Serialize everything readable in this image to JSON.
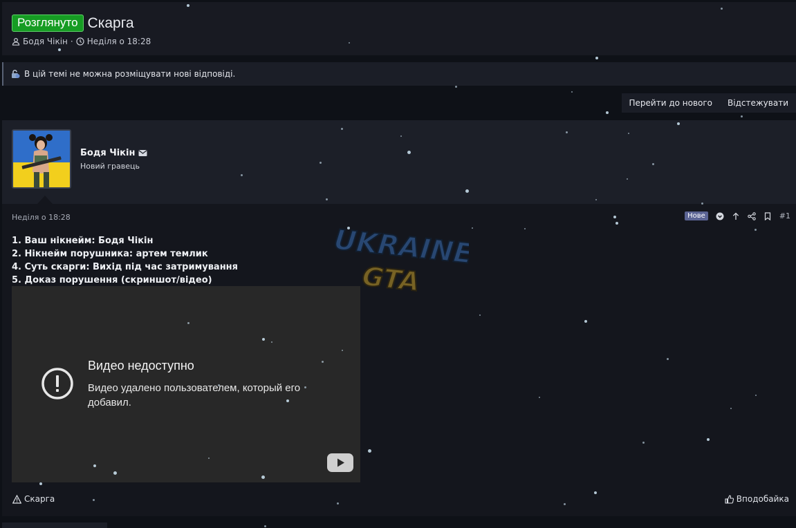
{
  "thread": {
    "status": "Розглянуто",
    "title": "Скарга",
    "author": "Бодя Чікін",
    "separator": "·",
    "date": "Неділя о 18:28"
  },
  "notice": {
    "text": "В цій темі не можна розміщувати нові відповіді."
  },
  "actions": {
    "goto_new": "Перейти до нового",
    "watch": "Відстежувати"
  },
  "post": {
    "user": {
      "name": "Бодя Чікін",
      "title": "Новий гравець"
    },
    "date": "Неділя о 18:28",
    "badge": "Нове",
    "number": "#1",
    "lines": [
      "1. Ваш нікнейм: Бодя Чікін",
      "2. Нікнейм порушника: артем темлик",
      "4. Суть скарги: Вихід під час затримування",
      "5. Доказ порушення (скриншот/відео)"
    ],
    "video": {
      "title": "Видео недоступно",
      "message": "Видео удалено пользователем, который его добавил."
    },
    "report_label": "Скарга",
    "like_label": "Вподобайка"
  },
  "watermark": {
    "line1": "UKRAINE",
    "line2": "GTA"
  },
  "colors": {
    "status_green": "#169c23",
    "badge": "#5b6494",
    "background": "#0e1117"
  }
}
